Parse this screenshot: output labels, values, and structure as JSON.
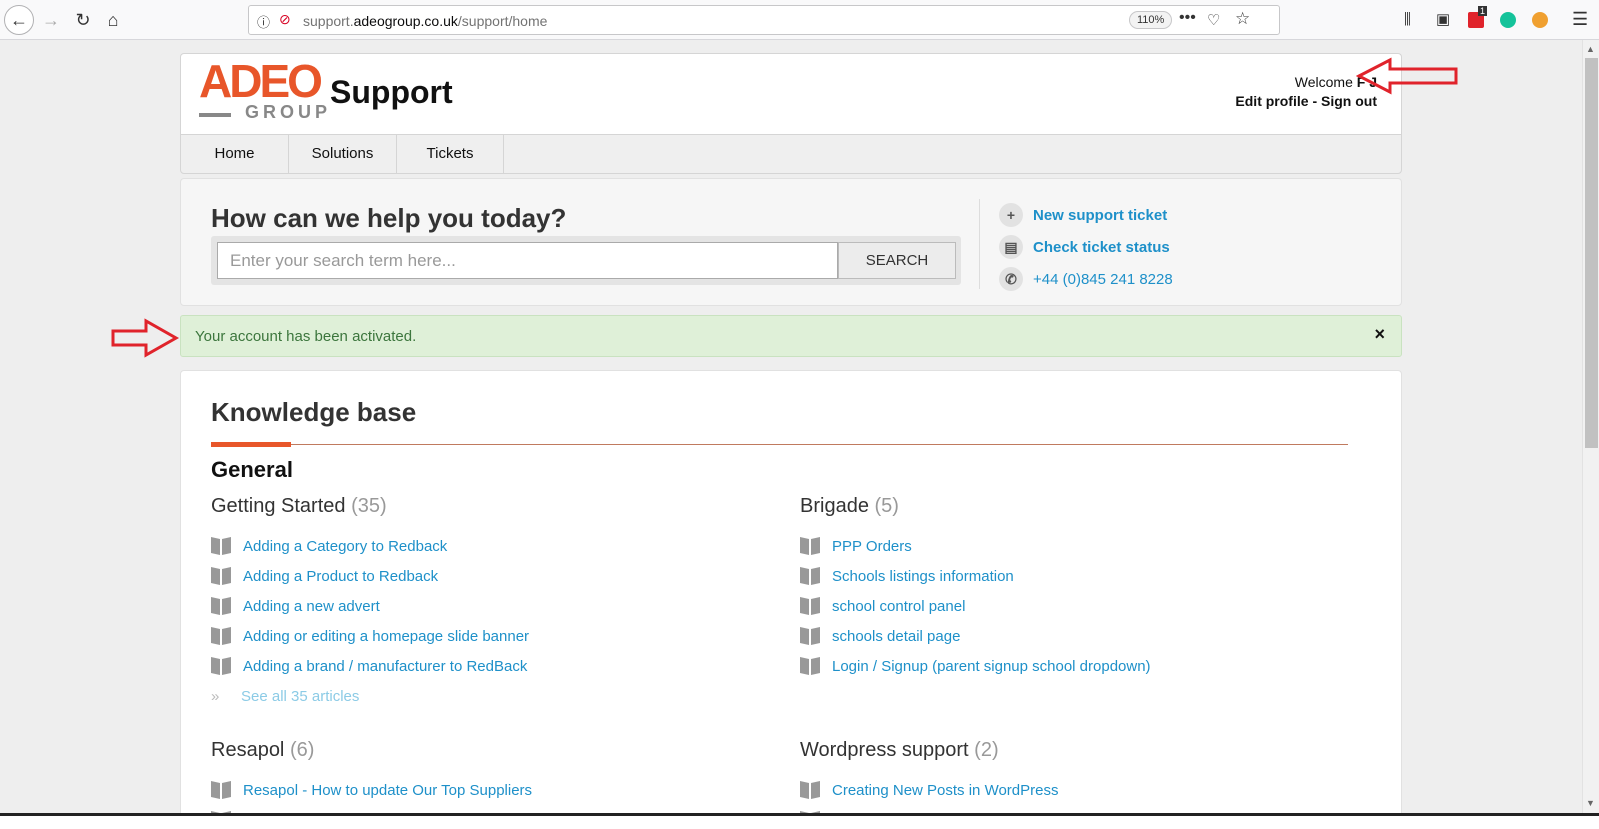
{
  "browser": {
    "url_prefix": "support.",
    "url_domain": "adeogroup.co.uk",
    "url_path": "/support/home",
    "zoom": "110%",
    "badge_count": "1"
  },
  "header": {
    "logo_text": "ADEO",
    "logo_sub": "GROUP",
    "title": "Support",
    "welcome_label": "Welcome",
    "user_name": "F J",
    "edit_profile": "Edit profile",
    "separator": "-",
    "sign_out": "Sign out"
  },
  "tabs": [
    {
      "label": "Home"
    },
    {
      "label": "Solutions"
    },
    {
      "label": "Tickets"
    }
  ],
  "help": {
    "title": "How can we help you today?",
    "search_placeholder": "Enter your search term here...",
    "search_button": "SEARCH",
    "links": {
      "new_ticket": "New support ticket",
      "check_status": "Check ticket status",
      "phone": "+44 (0)845 241 8228"
    }
  },
  "alert": {
    "message": "Your account has been activated.",
    "close": "×"
  },
  "kb": {
    "title": "Knowledge base",
    "section": "General",
    "categories": [
      {
        "name": "Getting Started",
        "count": "(35)",
        "articles": [
          "Adding a Category to Redback",
          "Adding a Product to Redback",
          "Adding a new advert",
          "Adding or editing a homepage slide banner",
          "Adding a brand / manufacturer to RedBack"
        ],
        "see_all": "See all 35 articles"
      },
      {
        "name": "Brigade",
        "count": "(5)",
        "articles": [
          "PPP Orders",
          "Schools listings information",
          "school control panel",
          "schools detail page",
          "Login / Signup (parent signup school dropdown)"
        ]
      },
      {
        "name": "Resapol",
        "count": "(6)",
        "articles": [
          "Resapol - How to update Our Top Suppliers"
        ]
      },
      {
        "name": "Wordpress support",
        "count": "(2)",
        "articles": [
          "Creating New Posts in WordPress"
        ]
      }
    ]
  },
  "colors": {
    "brand": "#e8562a",
    "link": "#1e90c9",
    "alert_bg": "#dff0d8",
    "annotation": "#e0232b"
  }
}
